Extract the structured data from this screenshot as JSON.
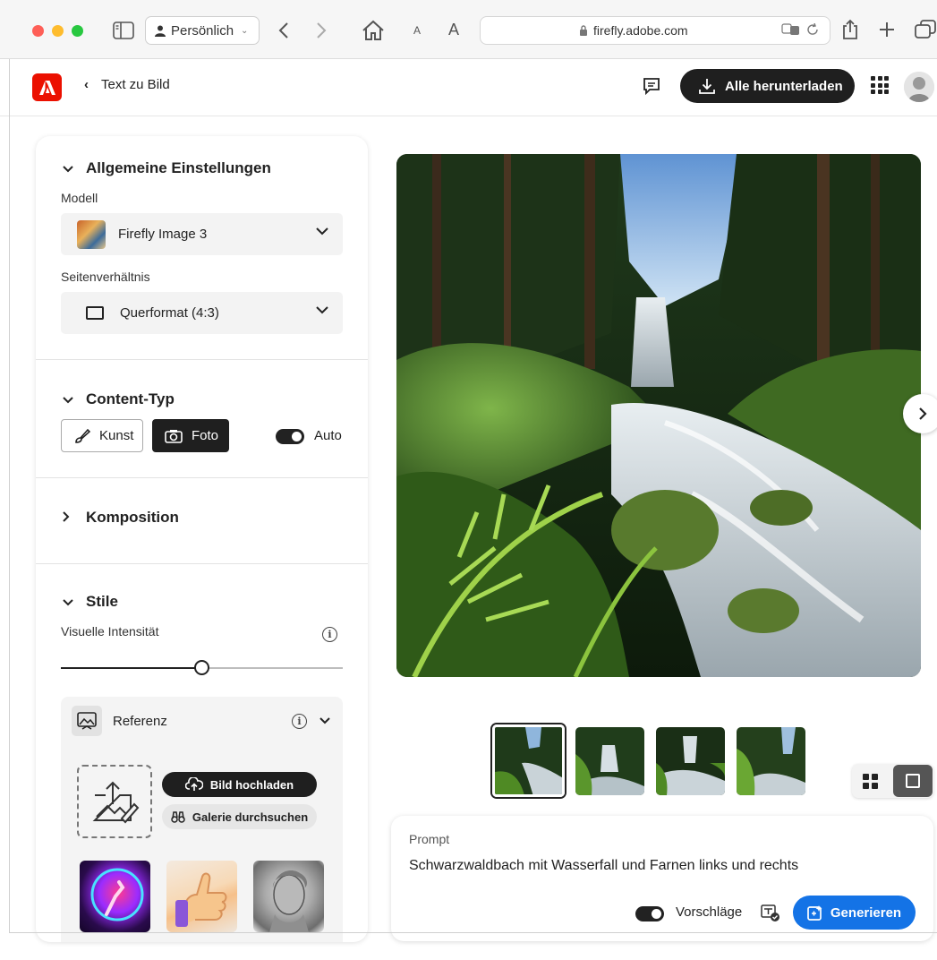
{
  "browser": {
    "profile_label": "Persönlich",
    "url": "firefly.adobe.com",
    "font_small": "A",
    "font_large": "A"
  },
  "header": {
    "back_label": "Text zu Bild",
    "download_label": "Alle herunterladen"
  },
  "general": {
    "title": "Allgemeine Einstellungen",
    "model_label": "Modell",
    "model_value": "Firefly Image 3",
    "ratio_label": "Seitenverhältnis",
    "ratio_value": "Querformat (4:3)"
  },
  "content_type": {
    "title": "Content-Typ",
    "art_label": "Kunst",
    "photo_label": "Foto",
    "auto_label": "Auto",
    "auto_on": true
  },
  "composition": {
    "title": "Komposition"
  },
  "styles": {
    "title": "Stile",
    "intensity_label": "Visuelle Intensität",
    "intensity_value": 0.5,
    "reference_label": "Referenz",
    "upload_label": "Bild hochladen",
    "gallery_label": "Galerie durchsuchen"
  },
  "prompt": {
    "label": "Prompt",
    "text": "Schwarzwaldbach mit Wasserfall und Farnen links und rechts",
    "suggestions_label": "Vorschläge",
    "generate_label": "Generieren"
  },
  "colors": {
    "adobe_red": "#eb1000",
    "generate_blue": "#1473e6",
    "dark_button": "#1f1f1f"
  }
}
